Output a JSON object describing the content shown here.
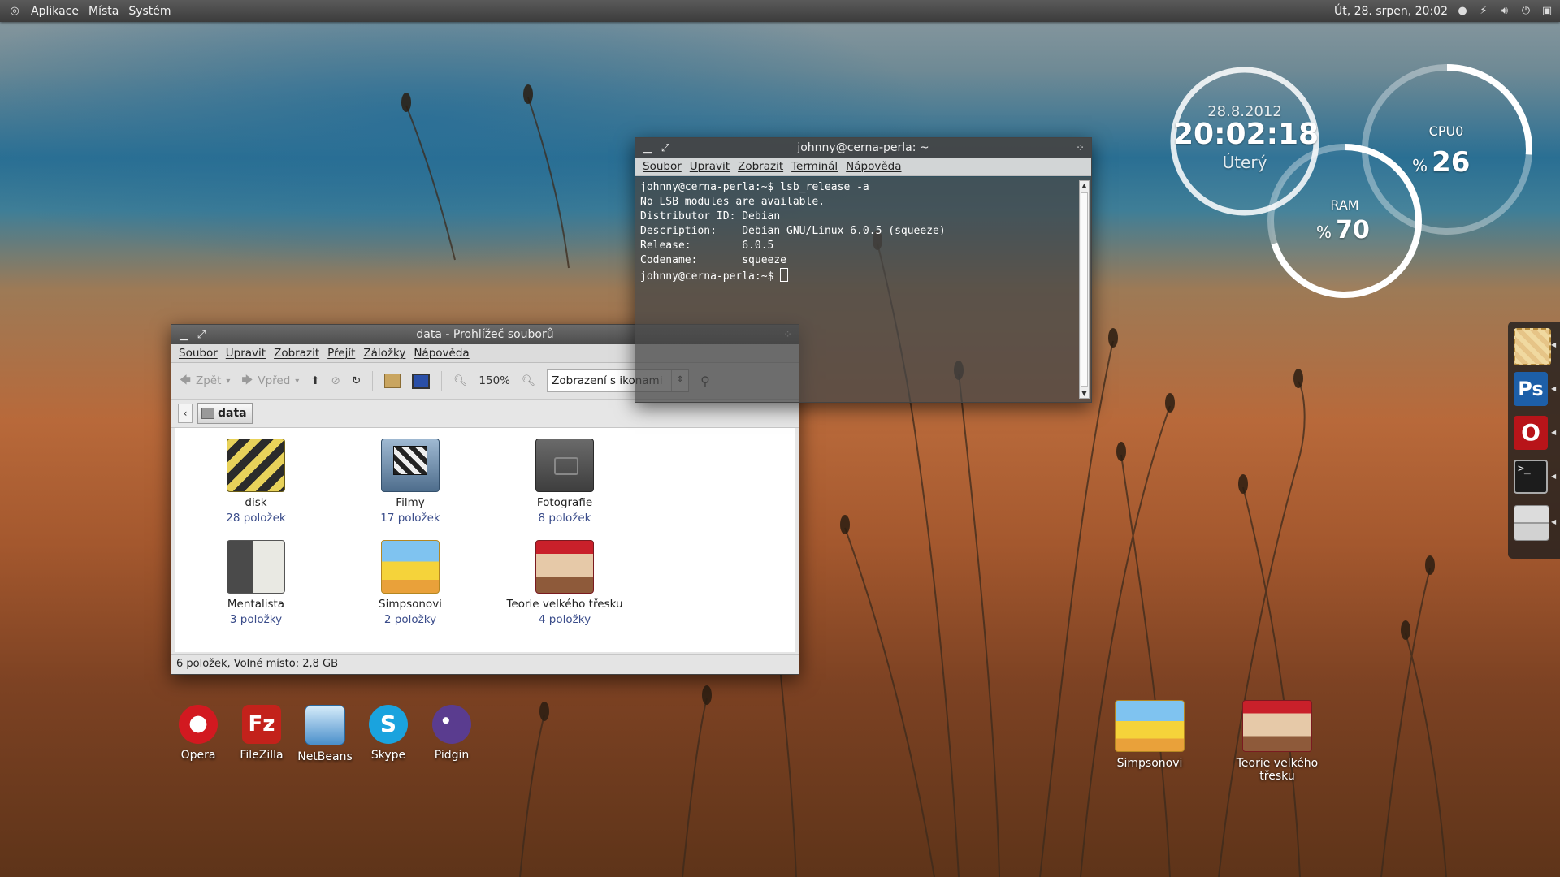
{
  "top_panel": {
    "menus": [
      "Aplikace",
      "Místa",
      "Systém"
    ],
    "clock": "Út, 28. srpen, 20:02",
    "tray_icons": [
      "chat-icon",
      "network-icon",
      "volume-icon",
      "power-icon",
      "display-icon"
    ]
  },
  "widgets": {
    "clock": {
      "date": "28.8.2012",
      "time": "20:02:18",
      "day": "Úterý"
    },
    "cpu": {
      "label": "CPU0",
      "unit": "%",
      "value": "26",
      "fraction": 0.26
    },
    "ram": {
      "label": "RAM",
      "unit": "%",
      "value": "70",
      "fraction": 0.7
    }
  },
  "terminal": {
    "title": "johnny@cerna-perla: ~",
    "menu": [
      "Soubor",
      "Upravit",
      "Zobrazit",
      "Terminál",
      "Nápověda"
    ],
    "lines": [
      "johnny@cerna-perla:~$ lsb_release -a",
      "No LSB modules are available.",
      "Distributor ID: Debian",
      "Description:    Debian GNU/Linux 6.0.5 (squeeze)",
      "Release:        6.0.5",
      "Codename:       squeeze",
      "johnny@cerna-perla:~$ "
    ]
  },
  "filemanager": {
    "title": "data - Prohlížeč souborů",
    "menu": [
      "Soubor",
      "Upravit",
      "Zobrazit",
      "Přejít",
      "Záložky",
      "Nápověda"
    ],
    "toolbar": {
      "back": "Zpět",
      "forward": "Vpřed",
      "zoom": "150%",
      "view_mode": "Zobrazení s ikonami"
    },
    "path": "data",
    "items": [
      {
        "name": "disk",
        "count": "28 položek",
        "icon": "drive-folder-icon"
      },
      {
        "name": "Filmy",
        "count": "17 položek",
        "icon": "video-folder-icon"
      },
      {
        "name": "Fotografie",
        "count": "8 položek",
        "icon": "photo-folder-icon"
      },
      {
        "name": "Mentalista",
        "count": "3 položky",
        "icon": "mentalist-folder-icon"
      },
      {
        "name": "Simpsonovi",
        "count": "2 položky",
        "icon": "simpsons-folder-icon"
      },
      {
        "name": "Teorie velkého třesku",
        "count": "4 položky",
        "icon": "bigbang-folder-icon"
      }
    ],
    "status": "6 položek, Volné místo: 2,8 GB"
  },
  "desktop_icons": [
    {
      "label": "Opera",
      "icon": "opera-icon",
      "color": "#c8141b"
    },
    {
      "label": "FileZilla",
      "icon": "filezilla-icon",
      "color": "#c3221b"
    },
    {
      "label": "NetBeans",
      "icon": "netbeans-icon",
      "color": "#4a8fcb"
    },
    {
      "label": "Skype",
      "icon": "skype-icon",
      "color": "#1aa3de"
    },
    {
      "label": "Pidgin",
      "icon": "pidgin-icon",
      "color": "#5a3c8f"
    }
  ],
  "desktop_folders": [
    {
      "label": "Simpsonovi",
      "icon": "simpsons-folder-icon"
    },
    {
      "label": "Teorie velkého třesku",
      "icon": "bigbang-folder-icon"
    }
  ],
  "dock_icons": [
    "mail-stamp-icon",
    "photoshop-icon",
    "opera-icon",
    "terminal-icon",
    "file-cabinet-icon"
  ],
  "dock_labels": {
    "photoshop": "Ps",
    "opera": "O",
    "terminal": ">_"
  }
}
